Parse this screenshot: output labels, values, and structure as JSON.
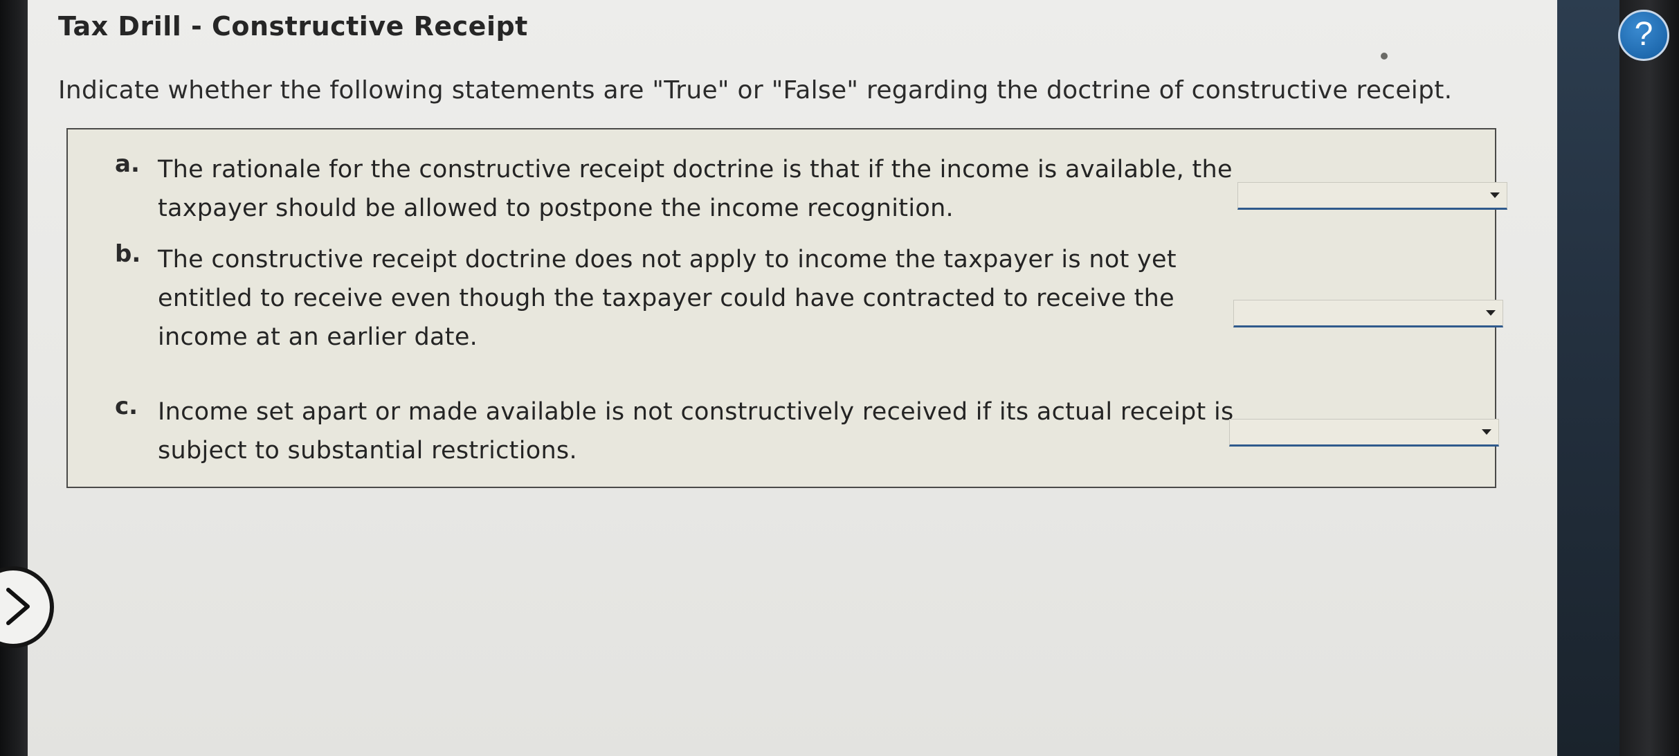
{
  "page": {
    "title": "Tax Drill - Constructive Receipt",
    "instructions": "Indicate whether the following statements are \"True\" or \"False\" regarding the doctrine of constructive receipt."
  },
  "questions": [
    {
      "letter": "a.",
      "text": "The rationale for the constructive receipt doctrine is that if the income is available, the taxpayer should be allowed to postpone the income recognition.",
      "selected": ""
    },
    {
      "letter": "b.",
      "text": "The constructive receipt doctrine does not apply to income the taxpayer is not yet entitled to receive even though the taxpayer could have contracted to receive the income at an earlier date.",
      "selected": ""
    },
    {
      "letter": "c.",
      "text": "Income set apart or made available is not constructively received if its actual receipt is subject to substantial restrictions.",
      "selected": ""
    }
  ],
  "help": {
    "label": "?"
  },
  "colors": {
    "accent": "#2f5a8c",
    "help_button": "#1f6aaf",
    "box_background": "#e8e7dd"
  },
  "icons": {
    "help": "question-mark-icon",
    "next": "chevron-right-icon",
    "dropdown": "caret-down-icon"
  }
}
